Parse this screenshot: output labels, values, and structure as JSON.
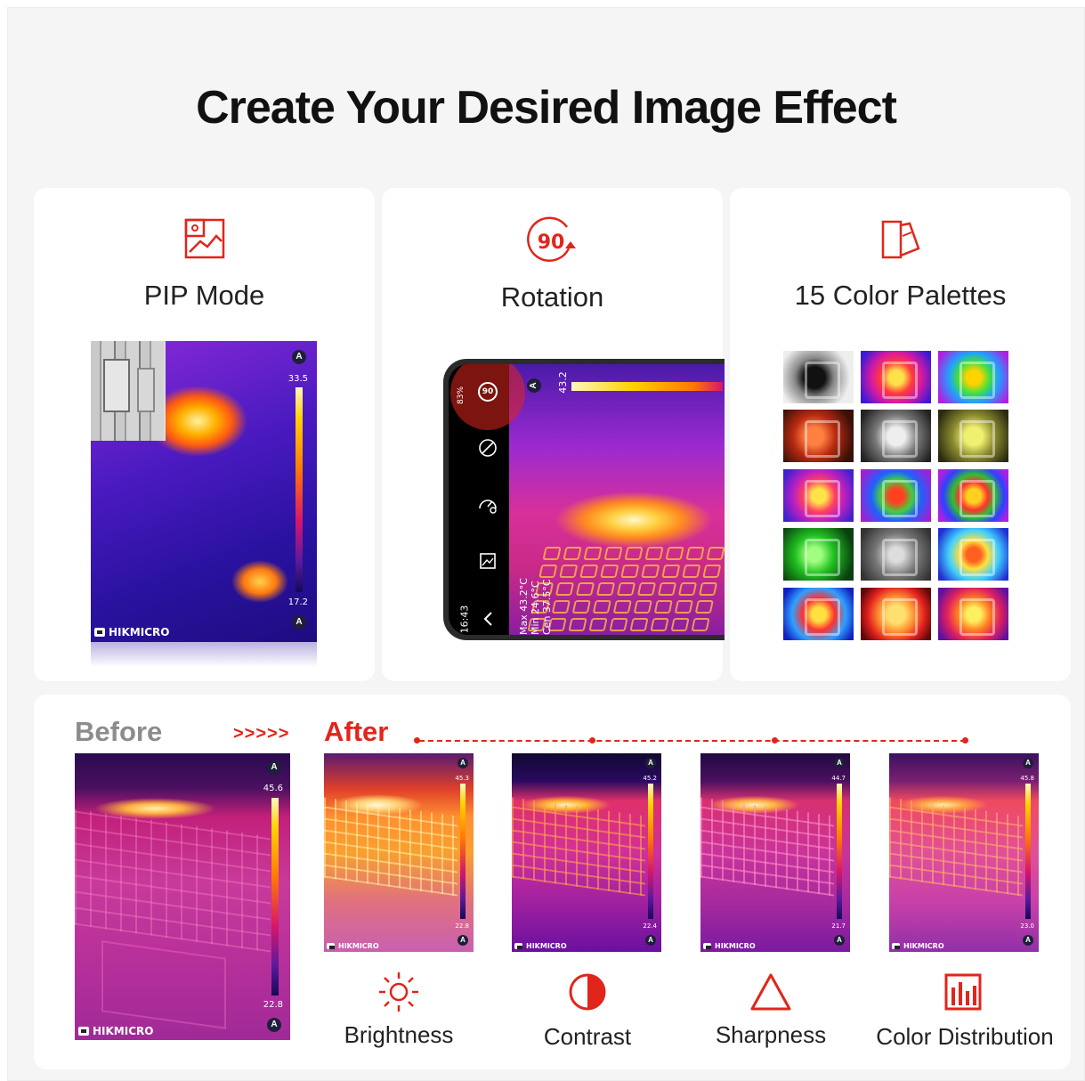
{
  "headline": "Create Your Desired Image Effect",
  "features": [
    {
      "title": "PIP Mode",
      "icon": "picture-in-picture-icon"
    },
    {
      "title": "Rotation",
      "icon": "rotate-90-icon",
      "icon_text": "90"
    },
    {
      "title": "15 Color Palettes",
      "icon": "color-palette-icon"
    }
  ],
  "pip_image": {
    "brand": "HIKMICRO",
    "scale_max": "33.5",
    "scale_min": "17.2",
    "scale_marker": "A"
  },
  "rotation_image": {
    "time": "16:43",
    "battery": "83%",
    "scale_max": "43.2",
    "scale_marker": "A",
    "readings": [
      "Max  43.2°C",
      "Min  24.6°C",
      "Cen  37.5°C"
    ],
    "rotate_button": "90"
  },
  "palette_count": 15,
  "before_after": {
    "before_label": "Before",
    "arrows": ">>>>>",
    "after_label": "After",
    "before_image": {
      "brand": "HIKMICRO",
      "scale_max": "45.6",
      "scale_min": "22.8",
      "scale_marker": "A"
    },
    "effects": [
      {
        "label": "Brightness",
        "icon": "brightness-icon",
        "scale_max": "45.3",
        "scale_min": "22.8",
        "brand": "HIKMICRO"
      },
      {
        "label": "Contrast",
        "icon": "contrast-icon",
        "scale_max": "45.2",
        "scale_min": "22.4",
        "brand": "HIKMICRO"
      },
      {
        "label": "Sharpness",
        "icon": "sharpness-icon",
        "scale_max": "44.7",
        "scale_min": "21.7",
        "brand": "HIKMICRO"
      },
      {
        "label": "Color Distribution",
        "icon": "color-distribution-icon",
        "scale_max": "45.8",
        "scale_min": "23.0",
        "brand": "HIKMICRO"
      }
    ]
  },
  "colors": {
    "accent": "#e1251b",
    "before_label": "#8c8c8c",
    "card_bg": "#ffffff",
    "page_bg": "#f5f5f5"
  }
}
